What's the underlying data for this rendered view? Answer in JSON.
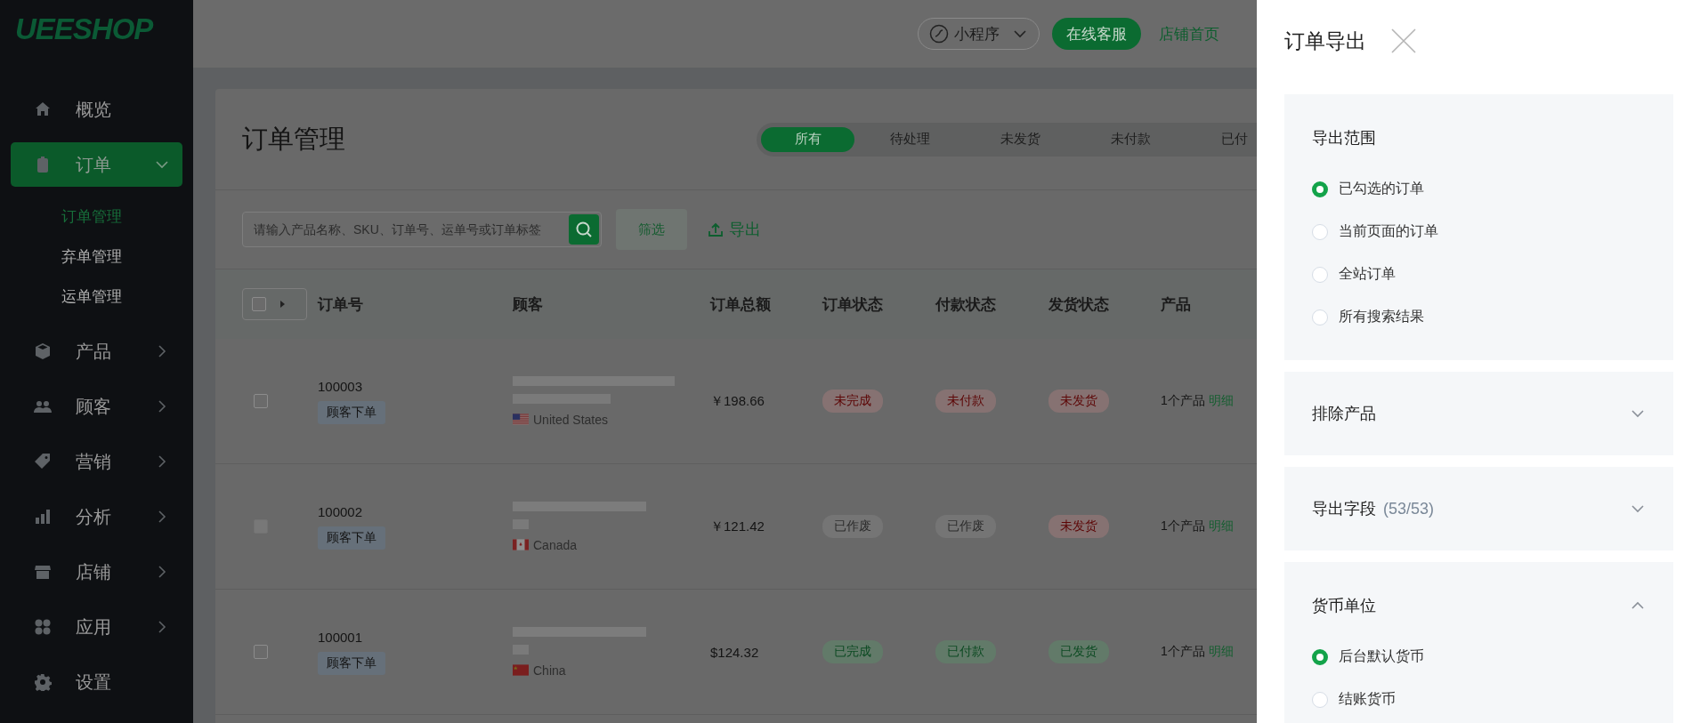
{
  "sidebar": {
    "logo": "UEESHOP",
    "items": [
      {
        "label": "概览",
        "selected": false
      },
      {
        "label": "订单",
        "selected": true,
        "expanded": true,
        "children": [
          {
            "label": "订单管理",
            "selected": true
          },
          {
            "label": "弃单管理",
            "selected": false
          },
          {
            "label": "运单管理",
            "selected": false
          }
        ]
      },
      {
        "label": "产品",
        "selected": false,
        "expanded": false
      },
      {
        "label": "顾客",
        "selected": false,
        "expanded": false
      },
      {
        "label": "营销",
        "selected": false,
        "expanded": false
      },
      {
        "label": "分析",
        "selected": false,
        "expanded": false
      },
      {
        "label": "店铺",
        "selected": false,
        "expanded": false
      },
      {
        "label": "应用",
        "selected": false,
        "expanded": false
      },
      {
        "label": "设置",
        "selected": false
      }
    ]
  },
  "topbar": {
    "mini_program": "小程序",
    "support_button": "在线客服",
    "store_home_link": "店铺首页"
  },
  "page": {
    "title": "订单管理",
    "tabs": [
      {
        "label": "所有",
        "selected": true
      },
      {
        "label": "待处理",
        "selected": false
      },
      {
        "label": "未发货",
        "selected": false
      },
      {
        "label": "未付款",
        "selected": false
      },
      {
        "label": "已付",
        "selected": false
      }
    ],
    "search": {
      "placeholder": "请输入产品名称、SKU、订单号、运单号或订单标签"
    },
    "filter_button": "筛选",
    "export_button": "导出",
    "table": {
      "header_checkbox": {
        "checked": false
      },
      "columns": [
        "订单号",
        "顾客",
        "订单总额",
        "订单状态",
        "付款状态",
        "发货状态",
        "产品"
      ],
      "rows": [
        {
          "checked": false,
          "disabled": false,
          "order_no": "100003",
          "source": "顾客下单",
          "country": "United States",
          "total": "￥198.66",
          "order_status": {
            "label": "未完成",
            "kind": "danger"
          },
          "payment_status": {
            "label": "未付款",
            "kind": "danger"
          },
          "shipping_status": {
            "label": "未发货",
            "kind": "danger"
          },
          "products": "1个产品",
          "detail_link": "明细"
        },
        {
          "checked": false,
          "disabled": true,
          "order_no": "100002",
          "source": "顾客下单",
          "country": "Canada",
          "total": "￥121.42",
          "order_status": {
            "label": "已作废",
            "kind": "muted"
          },
          "payment_status": {
            "label": "已作废",
            "kind": "muted"
          },
          "shipping_status": {
            "label": "未发货",
            "kind": "danger"
          },
          "products": "1个产品",
          "detail_link": "明细"
        },
        {
          "checked": false,
          "disabled": false,
          "order_no": "100001",
          "source": "顾客下单",
          "country": "China",
          "total": "$124.32",
          "order_status": {
            "label": "已完成",
            "kind": "success"
          },
          "payment_status": {
            "label": "已付款",
            "kind": "success"
          },
          "shipping_status": {
            "label": "已发货",
            "kind": "success"
          },
          "products": "1个产品",
          "detail_link": "明细"
        }
      ]
    }
  },
  "export_panel": {
    "title": "订单导出",
    "sections": [
      {
        "title": "导出范围",
        "options": [
          {
            "label": "已勾选的订单",
            "selected": true
          },
          {
            "label": "当前页面的订单",
            "selected": false
          },
          {
            "label": "全站订单",
            "selected": false
          },
          {
            "label": "所有搜索结果",
            "selected": false
          }
        ]
      },
      {
        "title": "排除产品",
        "expanded": false
      },
      {
        "title": "导出字段",
        "count": "(53/53)",
        "expanded": false
      },
      {
        "title": "货币单位",
        "expanded": true,
        "options": [
          {
            "label": "后台默认货币",
            "selected": true
          },
          {
            "label": "结账货币",
            "selected": false
          }
        ]
      }
    ]
  }
}
